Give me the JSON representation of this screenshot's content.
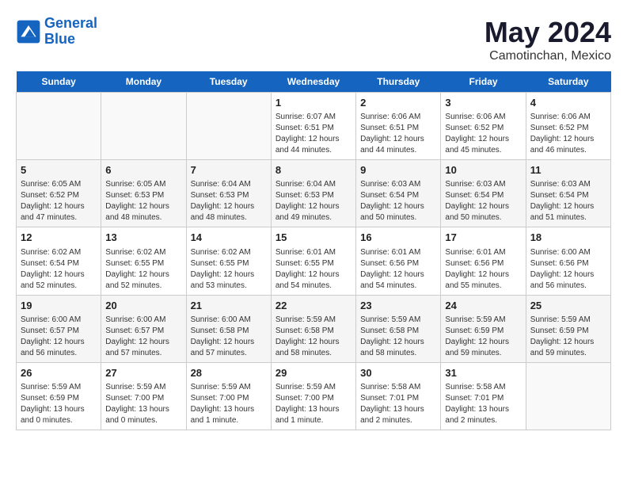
{
  "logo": {
    "line1": "General",
    "line2": "Blue"
  },
  "title": "May 2024",
  "subtitle": "Camotinchan, Mexico",
  "weekdays": [
    "Sunday",
    "Monday",
    "Tuesday",
    "Wednesday",
    "Thursday",
    "Friday",
    "Saturday"
  ],
  "weeks": [
    [
      {
        "day": "",
        "info": ""
      },
      {
        "day": "",
        "info": ""
      },
      {
        "day": "",
        "info": ""
      },
      {
        "day": "1",
        "info": "Sunrise: 6:07 AM\nSunset: 6:51 PM\nDaylight: 12 hours\nand 44 minutes."
      },
      {
        "day": "2",
        "info": "Sunrise: 6:06 AM\nSunset: 6:51 PM\nDaylight: 12 hours\nand 44 minutes."
      },
      {
        "day": "3",
        "info": "Sunrise: 6:06 AM\nSunset: 6:52 PM\nDaylight: 12 hours\nand 45 minutes."
      },
      {
        "day": "4",
        "info": "Sunrise: 6:06 AM\nSunset: 6:52 PM\nDaylight: 12 hours\nand 46 minutes."
      }
    ],
    [
      {
        "day": "5",
        "info": "Sunrise: 6:05 AM\nSunset: 6:52 PM\nDaylight: 12 hours\nand 47 minutes."
      },
      {
        "day": "6",
        "info": "Sunrise: 6:05 AM\nSunset: 6:53 PM\nDaylight: 12 hours\nand 48 minutes."
      },
      {
        "day": "7",
        "info": "Sunrise: 6:04 AM\nSunset: 6:53 PM\nDaylight: 12 hours\nand 48 minutes."
      },
      {
        "day": "8",
        "info": "Sunrise: 6:04 AM\nSunset: 6:53 PM\nDaylight: 12 hours\nand 49 minutes."
      },
      {
        "day": "9",
        "info": "Sunrise: 6:03 AM\nSunset: 6:54 PM\nDaylight: 12 hours\nand 50 minutes."
      },
      {
        "day": "10",
        "info": "Sunrise: 6:03 AM\nSunset: 6:54 PM\nDaylight: 12 hours\nand 50 minutes."
      },
      {
        "day": "11",
        "info": "Sunrise: 6:03 AM\nSunset: 6:54 PM\nDaylight: 12 hours\nand 51 minutes."
      }
    ],
    [
      {
        "day": "12",
        "info": "Sunrise: 6:02 AM\nSunset: 6:54 PM\nDaylight: 12 hours\nand 52 minutes."
      },
      {
        "day": "13",
        "info": "Sunrise: 6:02 AM\nSunset: 6:55 PM\nDaylight: 12 hours\nand 52 minutes."
      },
      {
        "day": "14",
        "info": "Sunrise: 6:02 AM\nSunset: 6:55 PM\nDaylight: 12 hours\nand 53 minutes."
      },
      {
        "day": "15",
        "info": "Sunrise: 6:01 AM\nSunset: 6:55 PM\nDaylight: 12 hours\nand 54 minutes."
      },
      {
        "day": "16",
        "info": "Sunrise: 6:01 AM\nSunset: 6:56 PM\nDaylight: 12 hours\nand 54 minutes."
      },
      {
        "day": "17",
        "info": "Sunrise: 6:01 AM\nSunset: 6:56 PM\nDaylight: 12 hours\nand 55 minutes."
      },
      {
        "day": "18",
        "info": "Sunrise: 6:00 AM\nSunset: 6:56 PM\nDaylight: 12 hours\nand 56 minutes."
      }
    ],
    [
      {
        "day": "19",
        "info": "Sunrise: 6:00 AM\nSunset: 6:57 PM\nDaylight: 12 hours\nand 56 minutes."
      },
      {
        "day": "20",
        "info": "Sunrise: 6:00 AM\nSunset: 6:57 PM\nDaylight: 12 hours\nand 57 minutes."
      },
      {
        "day": "21",
        "info": "Sunrise: 6:00 AM\nSunset: 6:58 PM\nDaylight: 12 hours\nand 57 minutes."
      },
      {
        "day": "22",
        "info": "Sunrise: 5:59 AM\nSunset: 6:58 PM\nDaylight: 12 hours\nand 58 minutes."
      },
      {
        "day": "23",
        "info": "Sunrise: 5:59 AM\nSunset: 6:58 PM\nDaylight: 12 hours\nand 58 minutes."
      },
      {
        "day": "24",
        "info": "Sunrise: 5:59 AM\nSunset: 6:59 PM\nDaylight: 12 hours\nand 59 minutes."
      },
      {
        "day": "25",
        "info": "Sunrise: 5:59 AM\nSunset: 6:59 PM\nDaylight: 12 hours\nand 59 minutes."
      }
    ],
    [
      {
        "day": "26",
        "info": "Sunrise: 5:59 AM\nSunset: 6:59 PM\nDaylight: 13 hours\nand 0 minutes."
      },
      {
        "day": "27",
        "info": "Sunrise: 5:59 AM\nSunset: 7:00 PM\nDaylight: 13 hours\nand 0 minutes."
      },
      {
        "day": "28",
        "info": "Sunrise: 5:59 AM\nSunset: 7:00 PM\nDaylight: 13 hours\nand 1 minute."
      },
      {
        "day": "29",
        "info": "Sunrise: 5:59 AM\nSunset: 7:00 PM\nDaylight: 13 hours\nand 1 minute."
      },
      {
        "day": "30",
        "info": "Sunrise: 5:58 AM\nSunset: 7:01 PM\nDaylight: 13 hours\nand 2 minutes."
      },
      {
        "day": "31",
        "info": "Sunrise: 5:58 AM\nSunset: 7:01 PM\nDaylight: 13 hours\nand 2 minutes."
      },
      {
        "day": "",
        "info": ""
      }
    ]
  ]
}
